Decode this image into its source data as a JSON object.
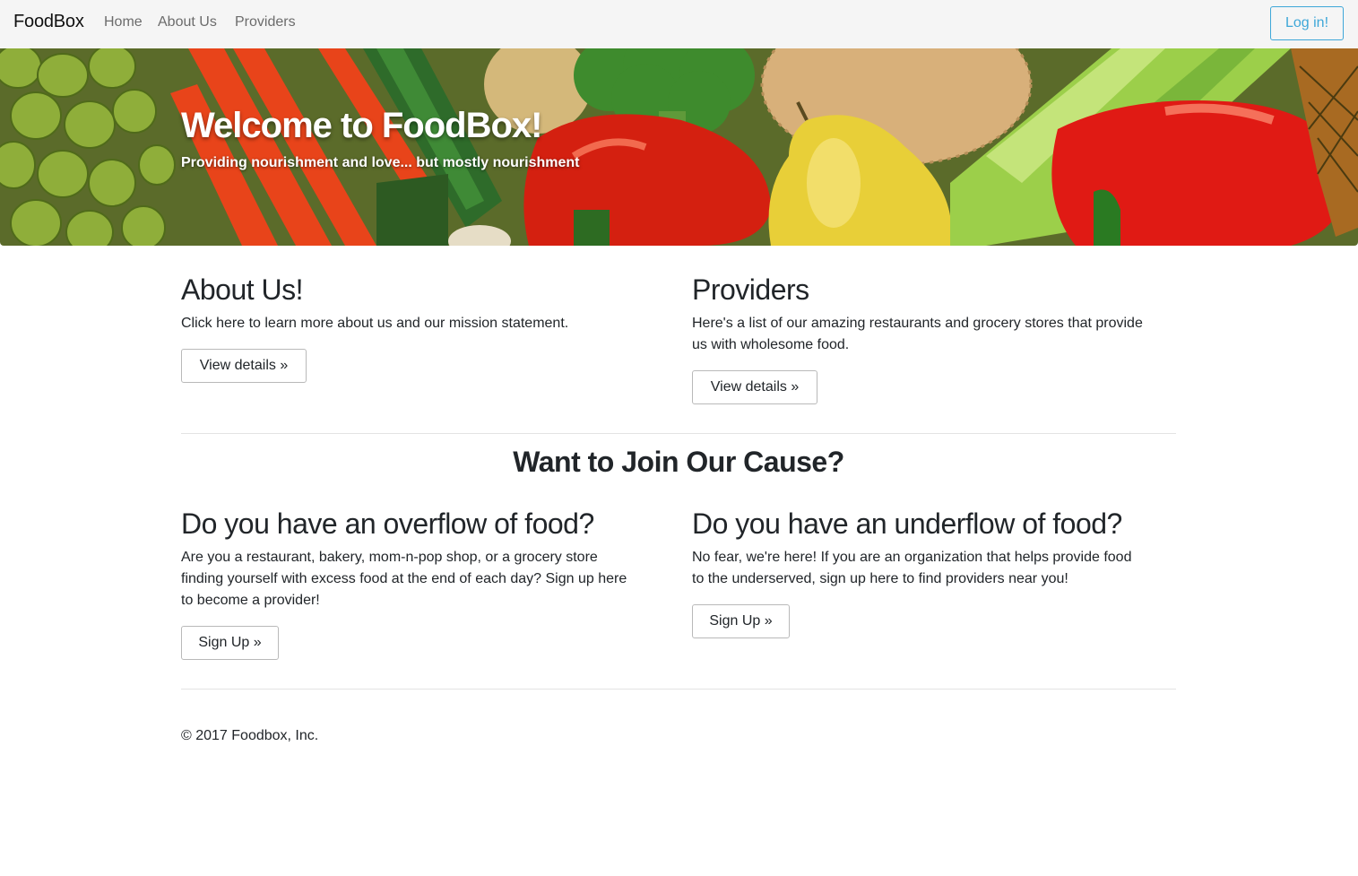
{
  "navbar": {
    "brand": "FoodBox",
    "links": [
      "Home",
      "About Us",
      "Providers"
    ],
    "login_label": "Log in!",
    "login_color": "#3ea7d8"
  },
  "hero": {
    "title": "Welcome to FoodBox!",
    "subtitle": "Providing nourishment and love... but mostly nourishment"
  },
  "about": {
    "heading": "About Us!",
    "text": "Click here to learn more about us and our mission statement.",
    "button": "View details »"
  },
  "providers": {
    "heading": "Providers",
    "text_lines": [
      "Here's a list of our amazing restaurants and grocery stores that provide",
      "us with wholesome food."
    ],
    "button": "View details »"
  },
  "join": {
    "heading": "Want to Join Our Cause?"
  },
  "overflow": {
    "heading": "Do you have an overflow of food?",
    "text_lines": [
      "Are you a restaurant, bakery, mom-n-pop shop, or a grocery store",
      "finding yourself with excess food at the end of each day? Sign up here",
      "to become a provider!"
    ],
    "button": "Sign Up »"
  },
  "underflow": {
    "heading": "Do you have an underflow of food?",
    "text_lines": [
      "No fear, we're here! If you are an organization that helps provide food",
      "to the underserved, sign up here to find providers near you!"
    ],
    "button": "Sign Up »"
  },
  "footer": {
    "text": "© 2017 Foodbox, Inc."
  }
}
